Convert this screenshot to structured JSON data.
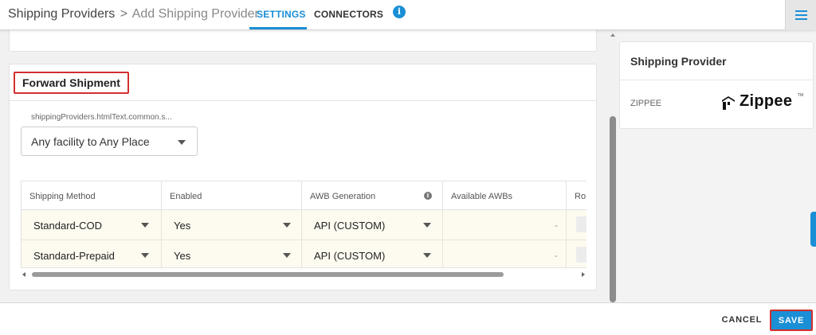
{
  "header": {
    "breadcrumb_parent": "Shipping Providers",
    "breadcrumb_separator": ">",
    "breadcrumb_current": "Add Shipping Provider",
    "tabs": [
      {
        "label": "SETTINGS",
        "active": true
      },
      {
        "label": "CONNECTORS",
        "active": false
      }
    ],
    "info_icon": "info-icon",
    "menu_icon": "hamburger-menu-icon"
  },
  "forward_shipment": {
    "title": "Forward Shipment",
    "field_label": "shippingProviders.htmlText.common.s...",
    "field_value": "Any facility to Any Place",
    "table": {
      "headers": [
        "Shipping Method",
        "Enabled",
        "AWB Generation",
        "Available AWBs",
        "Ro"
      ],
      "rows": [
        {
          "method": "Standard-COD",
          "enabled": "Yes",
          "awb": "API (CUSTOM)",
          "available": "-"
        },
        {
          "method": "Standard-Prepaid",
          "enabled": "Yes",
          "awb": "API (CUSTOM)",
          "available": "-"
        }
      ]
    }
  },
  "provider_panel": {
    "title": "Shipping Provider",
    "name": "ZIPPEE",
    "logo_text": "Zippee",
    "logo_tm": "TM"
  },
  "footer": {
    "cancel_label": "CANCEL",
    "save_label": "SAVE"
  },
  "colors": {
    "accent": "#1a8fd6",
    "highlight_border": "#d32f2f",
    "row_background": "#fdfaef"
  }
}
